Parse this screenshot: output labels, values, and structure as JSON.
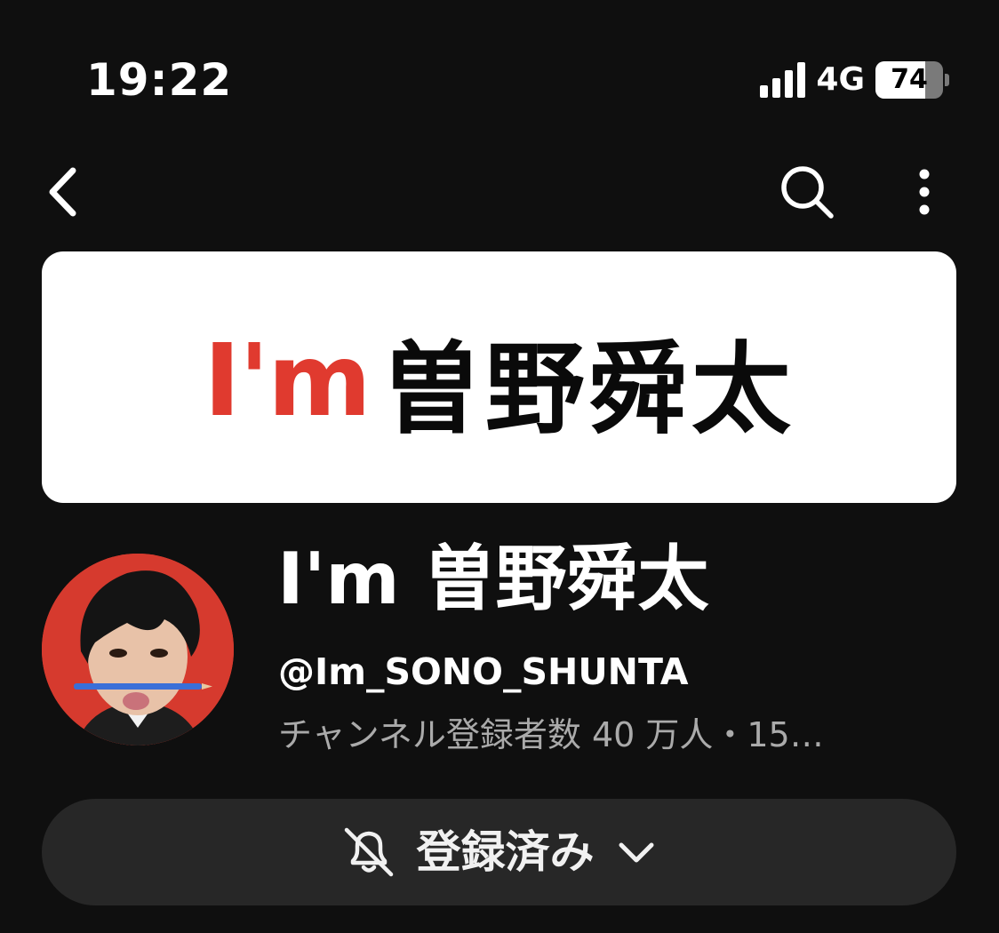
{
  "status_bar": {
    "time": "19:22",
    "network": "4G",
    "battery_percent": 74,
    "battery_text": "74",
    "signal_bars_filled": 4,
    "signal_bars_total": 4
  },
  "nav": {
    "back_icon": "chevron-left-icon",
    "search_icon": "search-icon",
    "more_icon": "more-vertical-icon"
  },
  "banner": {
    "logo_accent": "I'm",
    "logo_main": "曽野舜太",
    "accent_color": "#e03a2f"
  },
  "channel": {
    "name": "I'm 曽野舜太",
    "handle": "@Im_SONO_SHUNTA",
    "meta": "チャンネル登録者数 40 万人・15…",
    "avatar_bg": "#d63a2e"
  },
  "subscribe": {
    "label": "登録済み",
    "bell_icon": "bell-off-icon",
    "chevron_icon": "chevron-down-icon"
  },
  "colors": {
    "background": "#0f0f0f",
    "button_bg": "#272727",
    "secondary_text": "#aaaaaa"
  }
}
